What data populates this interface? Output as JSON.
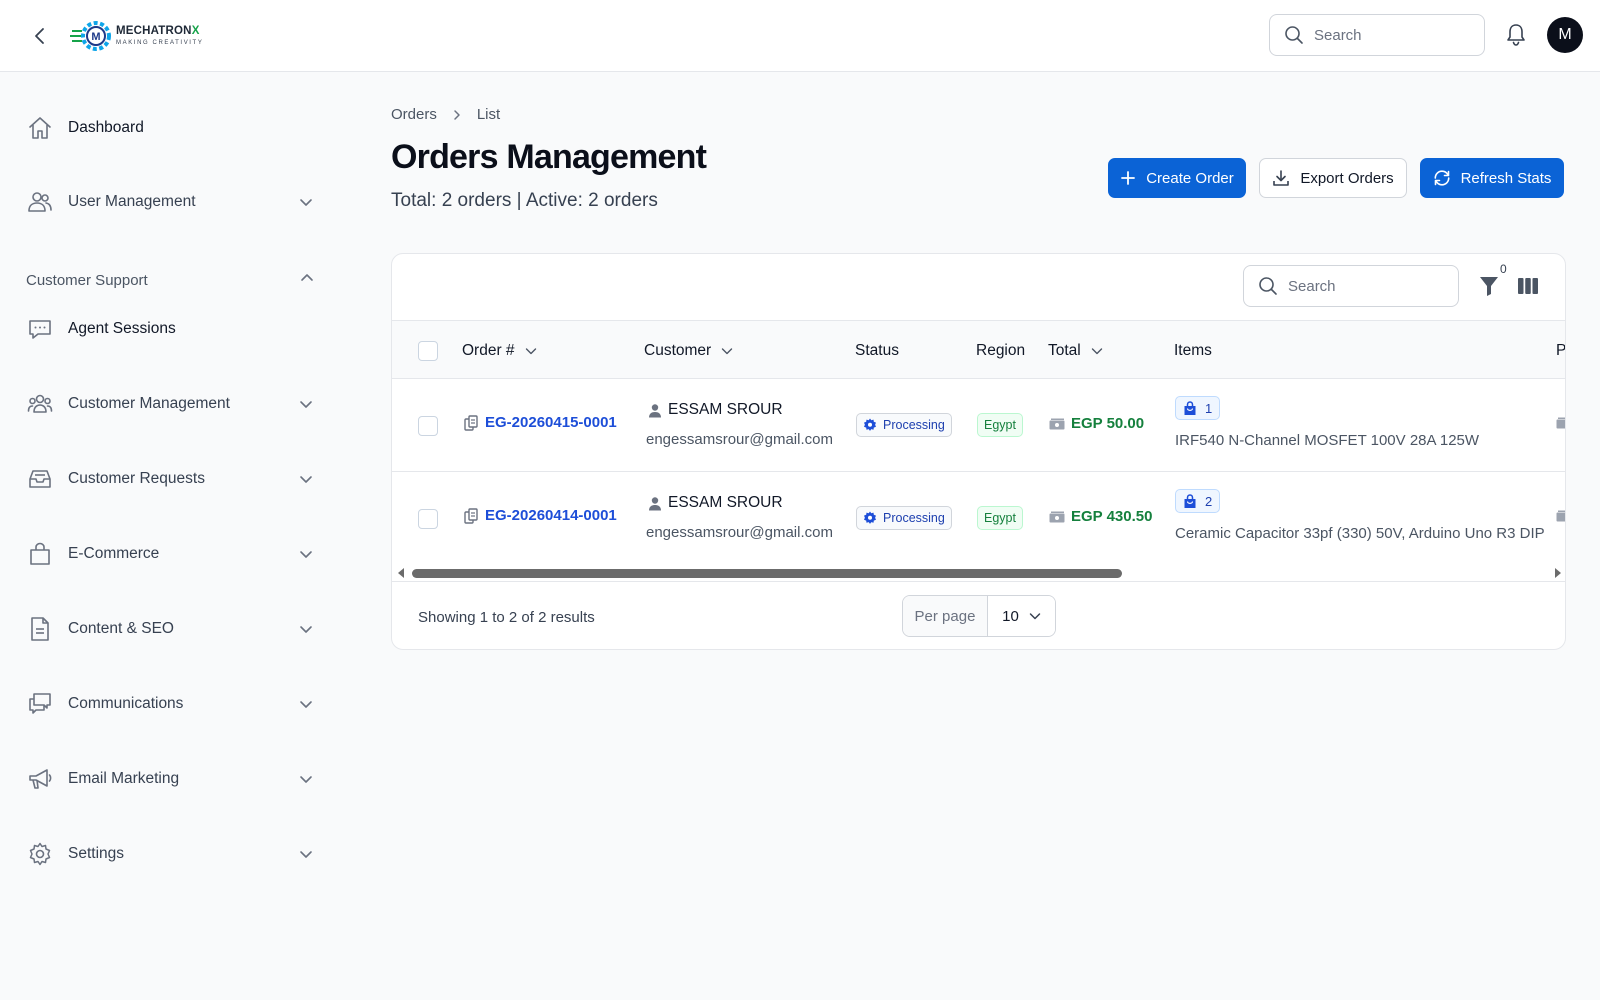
{
  "app": {
    "brand_name": "MECHATRON",
    "brand_x": "X",
    "brand_tagline": "MAKING CREATIVITY",
    "avatar_initial": "M"
  },
  "topbar": {
    "search_placeholder": "Search"
  },
  "sidebar": {
    "items": [
      {
        "label": "Dashboard",
        "icon": "home-icon"
      },
      {
        "label": "User Management",
        "icon": "users-icon"
      },
      {
        "label": "Agent Sessions",
        "icon": "chat-icon"
      },
      {
        "label": "Customer Management",
        "icon": "user-group-icon"
      },
      {
        "label": "Customer Requests",
        "icon": "inbox-icon"
      },
      {
        "label": "E-Commerce",
        "icon": "shopping-bag-icon"
      },
      {
        "label": "Content & SEO",
        "icon": "document-icon"
      },
      {
        "label": "Communications",
        "icon": "chat-bubbles-icon"
      },
      {
        "label": "Email Marketing",
        "icon": "megaphone-icon"
      },
      {
        "label": "Settings",
        "icon": "gear-icon"
      }
    ],
    "group_customer_support": "Customer Support"
  },
  "breadcrumb": {
    "root": "Orders",
    "current": "List"
  },
  "page": {
    "title": "Orders Management",
    "subtitle": "Total: 2 orders | Active: 2 orders"
  },
  "actions": {
    "create": "Create Order",
    "export": "Export Orders",
    "refresh": "Refresh Stats"
  },
  "table": {
    "search_placeholder": "Search",
    "filter_count": "0",
    "columns": {
      "order": "Order #",
      "customer": "Customer",
      "status": "Status",
      "region": "Region",
      "total": "Total",
      "items": "Items",
      "next": "P"
    },
    "rows": [
      {
        "order": "EG-20260415-0001",
        "customer_name": "ESSAM SROUR",
        "customer_email": "engessamsrour@gmail.com",
        "status": "Processing",
        "region": "Egypt",
        "total": "EGP 50.00",
        "items_count": "1",
        "items_text": "IRF540 N-Channel MOSFET 100V 28A 125W"
      },
      {
        "order": "EG-20260414-0001",
        "customer_name": "ESSAM SROUR",
        "customer_email": "engessamsrour@gmail.com",
        "status": "Processing",
        "region": "Egypt",
        "total": "EGP 430.50",
        "items_count": "2",
        "items_text": "Ceramic Capacitor 33pf (330) 50V, Arduino Uno R3 DIP"
      }
    ]
  },
  "pagination": {
    "showing": "Showing 1 to 2 of 2 results",
    "per_page_label": "Per page",
    "per_page_value": "10"
  },
  "colors": {
    "primary": "#0b63d6",
    "success": "#15803d",
    "link": "#1d4ed8"
  }
}
